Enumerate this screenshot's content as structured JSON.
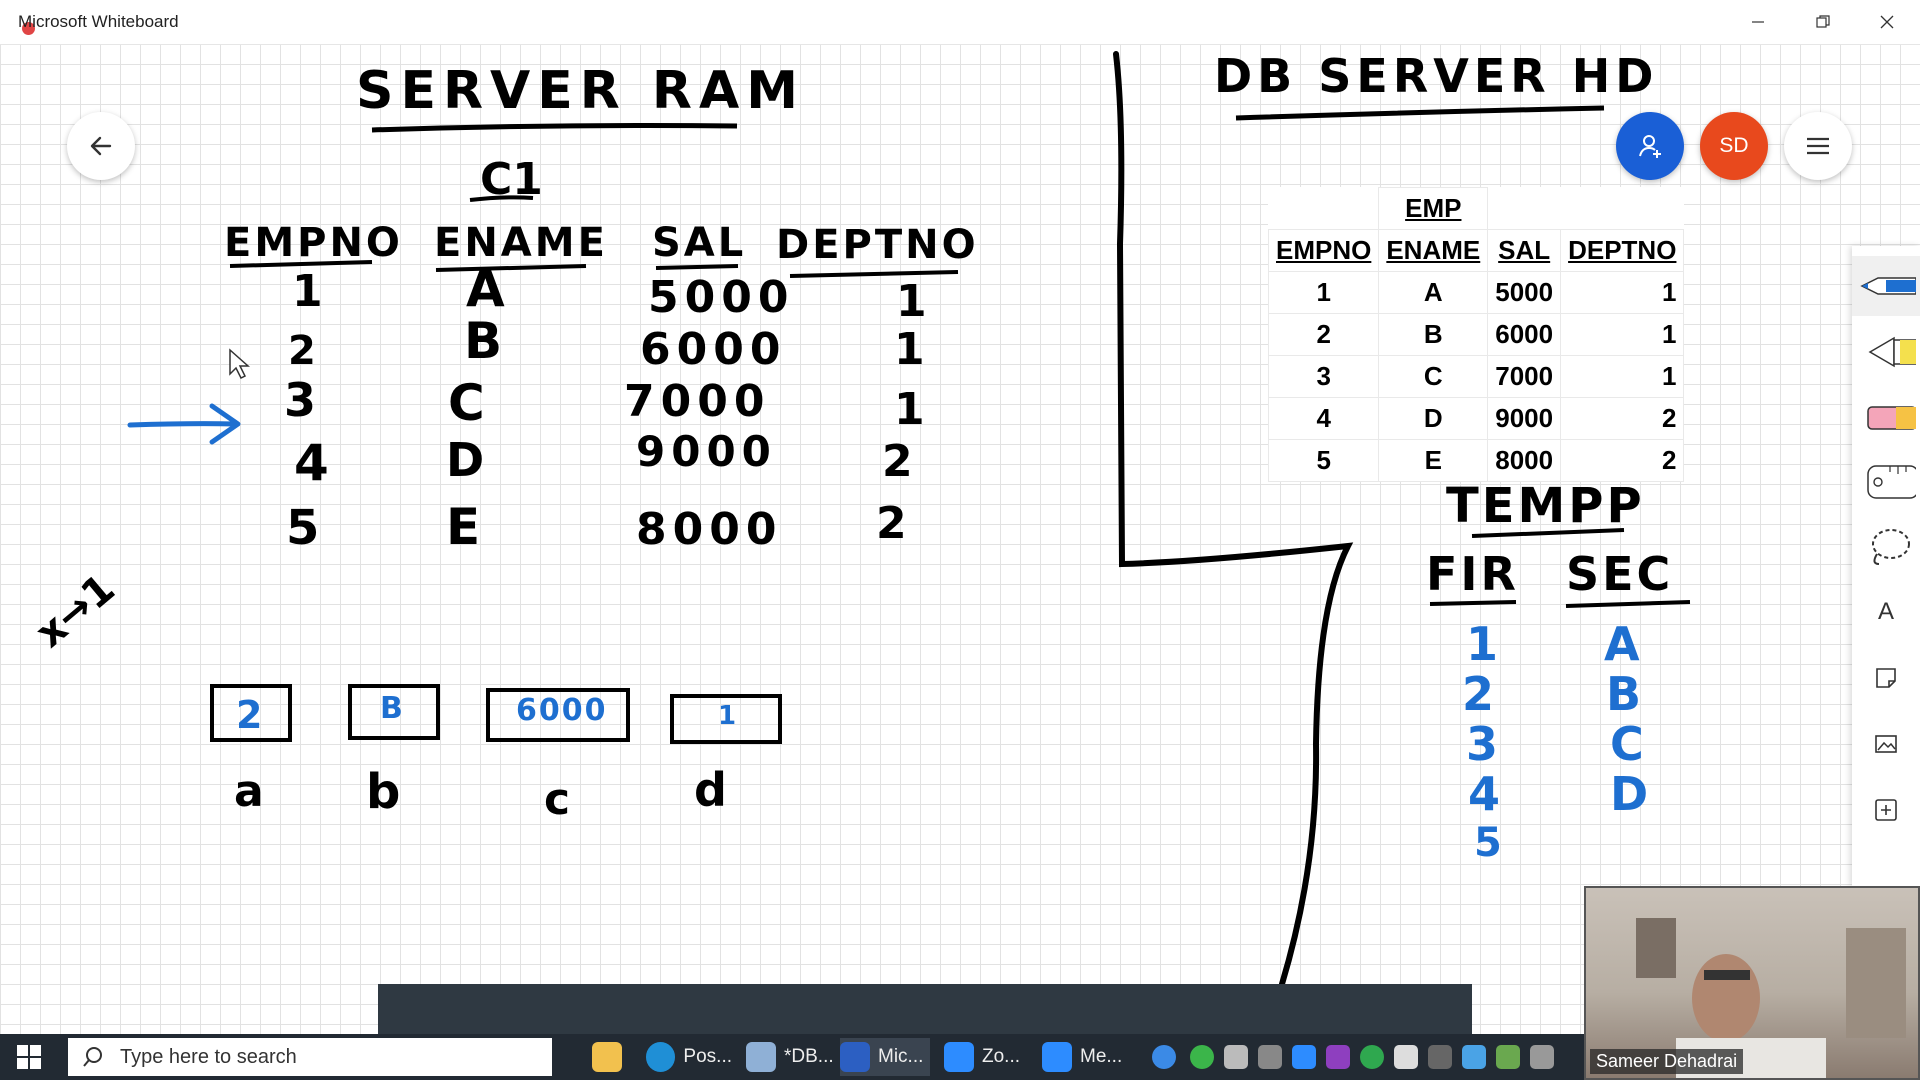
{
  "window": {
    "title": "Microsoft Whiteboard"
  },
  "whiteboard": {
    "left": {
      "heading": "SERVER RAM",
      "subheading": "C1",
      "columns": [
        "EMPNO",
        "ENAME",
        "SAL",
        "DEPTNO"
      ],
      "rows": [
        [
          "1",
          "A",
          "5000",
          "1"
        ],
        [
          "2",
          "B",
          "6000",
          "1"
        ],
        [
          "3",
          "C",
          "7000",
          "1"
        ],
        [
          "4",
          "D",
          "9000",
          "2"
        ],
        [
          "5",
          "E",
          "8000",
          "2"
        ]
      ],
      "fetch_note": "x→1",
      "variables": [
        {
          "value": "2",
          "label": "a"
        },
        {
          "value": "B",
          "label": "b"
        },
        {
          "value": "6000",
          "label": "c"
        },
        {
          "value": "1",
          "label": "d"
        }
      ]
    },
    "right": {
      "heading": "DB SERVER HD",
      "emp_table": {
        "title": "EMP",
        "columns": [
          "EMPNO",
          "ENAME",
          "SAL",
          "DEPTNO"
        ],
        "rows": [
          [
            "1",
            "A",
            "5000",
            "1"
          ],
          [
            "2",
            "B",
            "6000",
            "1"
          ],
          [
            "3",
            "C",
            "7000",
            "1"
          ],
          [
            "4",
            "D",
            "9000",
            "2"
          ],
          [
            "5",
            "E",
            "8000",
            "2"
          ]
        ]
      },
      "tempp": {
        "title": "TEMPP",
        "columns": [
          "FIR",
          "SEC"
        ],
        "fir": [
          "1",
          "2",
          "3",
          "4",
          "5"
        ],
        "sec": [
          "A",
          "B",
          "C",
          "D"
        ]
      }
    }
  },
  "controls": {
    "avatar_initials": "SD"
  },
  "toolbar": {
    "text_tool_label": "A"
  },
  "taskbar": {
    "search_placeholder": "Type here to search",
    "tasks": [
      "Pos...",
      "*DB...",
      "Mic...",
      "Zo...",
      "Me..."
    ]
  },
  "webcam": {
    "participant_name": "Sameer Dehadrai"
  },
  "colors": {
    "ink_black": "#000000",
    "ink_blue": "#1e6fd0",
    "accent_blue": "#1a5fd6",
    "avatar_orange": "#e8491d",
    "taskbar": "#222a33"
  }
}
